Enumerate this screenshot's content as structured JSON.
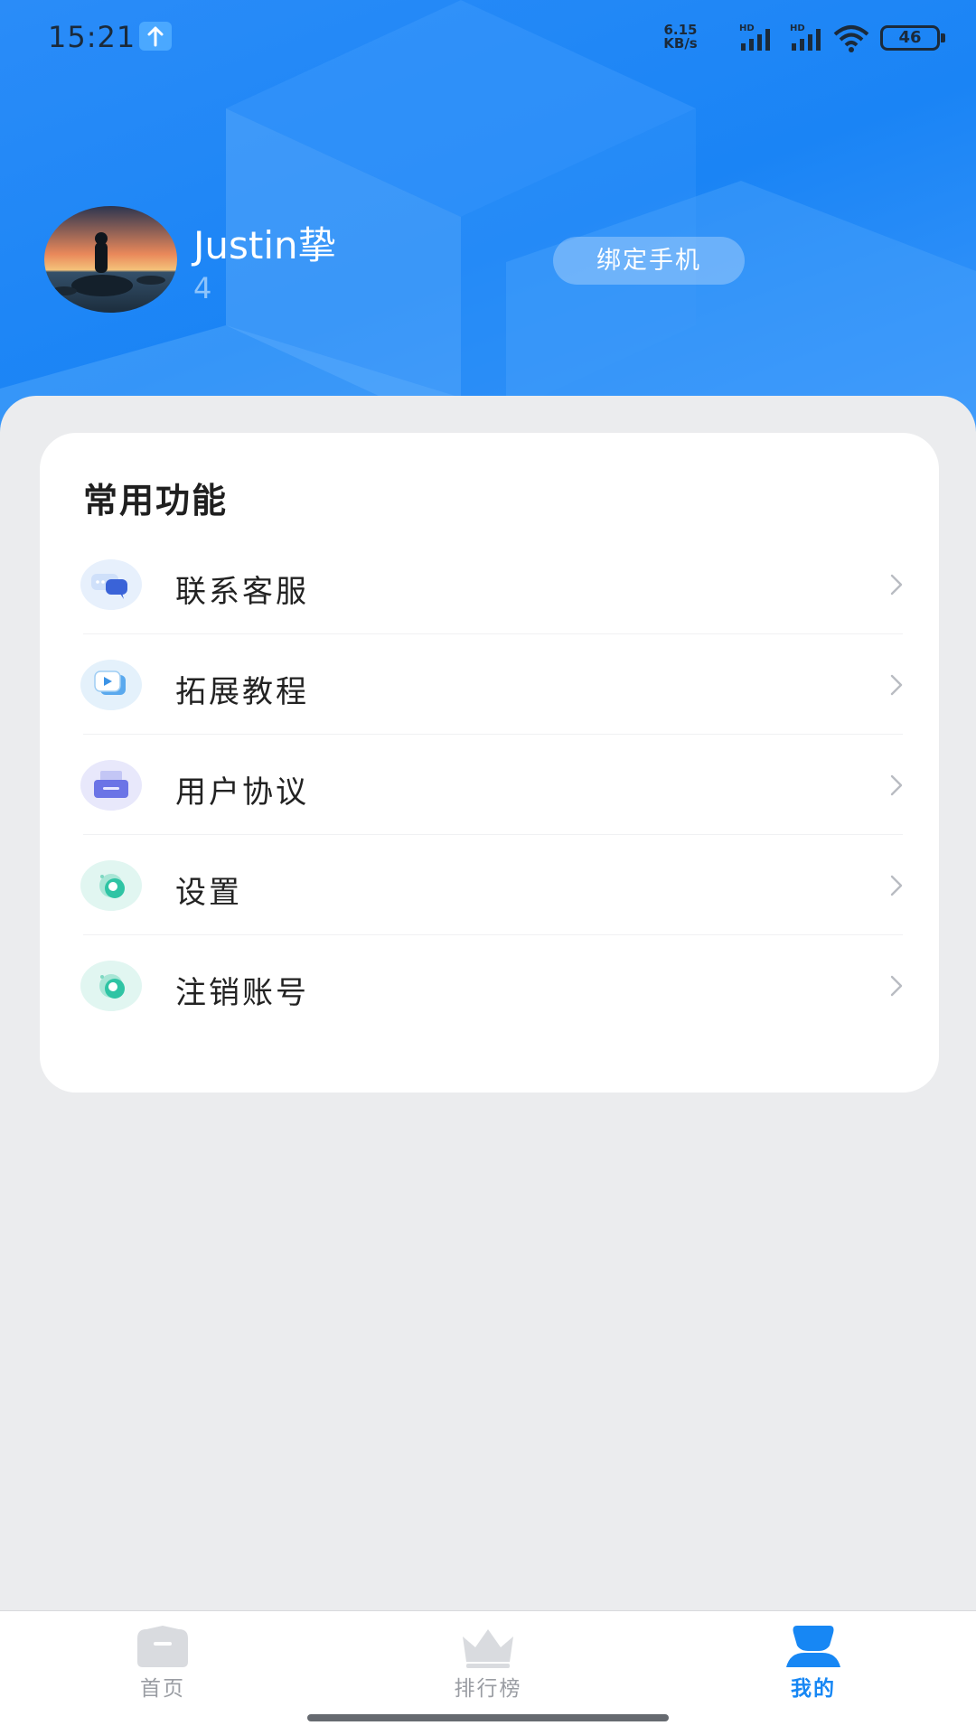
{
  "status_bar": {
    "time": "15:21",
    "net_speed_top": "6.15",
    "net_speed_bottom": "KB/s",
    "battery": "46"
  },
  "profile": {
    "username": "Justin挚",
    "user_id": "4",
    "bind_phone_label": "绑定手机"
  },
  "card": {
    "title": "常用功能",
    "items": [
      {
        "label": "联系客服",
        "icon": "customer-service-icon"
      },
      {
        "label": "拓展教程",
        "icon": "video-tutorial-icon"
      },
      {
        "label": "用户协议",
        "icon": "agreement-icon"
      },
      {
        "label": "设置",
        "icon": "settings-icon"
      },
      {
        "label": "注销账号",
        "icon": "deactivate-account-icon"
      }
    ]
  },
  "bottom_nav": {
    "items": [
      {
        "label": "首页",
        "icon": "home-icon",
        "active": false
      },
      {
        "label": "排行榜",
        "icon": "crown-icon",
        "active": false
      },
      {
        "label": "我的",
        "icon": "user-icon",
        "active": true
      }
    ]
  },
  "colors": {
    "accent": "#1787f4",
    "header_blue": "#1a84f5",
    "page_bg": "#ebecee"
  }
}
